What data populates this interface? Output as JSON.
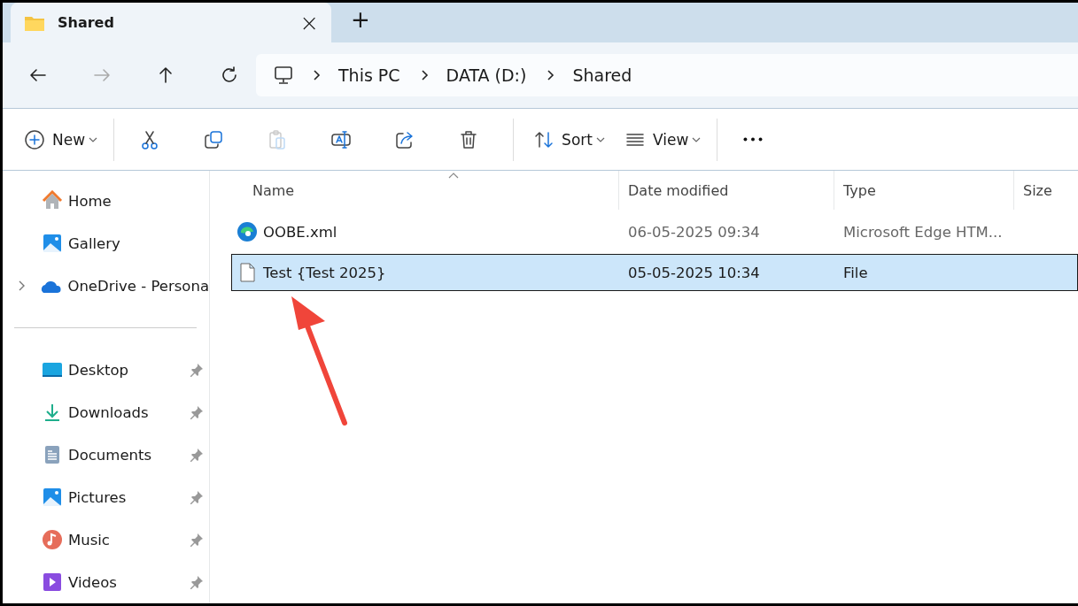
{
  "tab": {
    "title": "Shared",
    "close": "×",
    "new_tab": "+"
  },
  "nav_buttons": [
    {
      "kind": "back",
      "disabled": false
    },
    {
      "kind": "forward",
      "disabled": true
    },
    {
      "kind": "up",
      "disabled": false
    },
    {
      "kind": "refresh",
      "disabled": false
    }
  ],
  "breadcrumb": [
    "This PC",
    "DATA (D:)",
    "Shared"
  ],
  "toolbar": [
    {
      "kind": "new",
      "label": "New",
      "disabled": false
    },
    {
      "kind": "sep"
    },
    {
      "kind": "cut",
      "disabled": false
    },
    {
      "kind": "copy",
      "disabled": false
    },
    {
      "kind": "paste",
      "disabled": true
    },
    {
      "kind": "rename",
      "disabled": false
    },
    {
      "kind": "share",
      "disabled": false
    },
    {
      "kind": "delete",
      "disabled": false
    },
    {
      "kind": "sep"
    },
    {
      "kind": "sort",
      "label": "Sort",
      "disabled": false
    },
    {
      "kind": "view",
      "label": "View",
      "disabled": false
    },
    {
      "kind": "sep"
    },
    {
      "kind": "more",
      "disabled": false
    }
  ],
  "sidebar": {
    "items": [
      {
        "kind": "home",
        "label": "Home",
        "pinned": false,
        "expandable": false
      },
      {
        "kind": "gallery",
        "label": "Gallery",
        "pinned": false,
        "expandable": false
      },
      {
        "kind": "cloud",
        "label": "OneDrive - Persona",
        "pinned": false,
        "expandable": true
      },
      {
        "kind": "divider"
      },
      {
        "kind": "desktop",
        "label": "Desktop",
        "pinned": true,
        "expandable": false
      },
      {
        "kind": "downloads",
        "label": "Downloads",
        "pinned": true,
        "expandable": false
      },
      {
        "kind": "documents",
        "label": "Documents",
        "pinned": true,
        "expandable": false
      },
      {
        "kind": "pictures",
        "label": "Pictures",
        "pinned": true,
        "expandable": false
      },
      {
        "kind": "music",
        "label": "Music",
        "pinned": true,
        "expandable": false
      },
      {
        "kind": "videos",
        "label": "Videos",
        "pinned": true,
        "expandable": false
      }
    ]
  },
  "table": {
    "columns": [
      "Name",
      "Date modified",
      "Type",
      "Size"
    ],
    "rows": [
      {
        "kind": "edge",
        "name": "OOBE.xml",
        "date": "06-05-2025 09:34",
        "type": "Microsoft Edge HTM...",
        "selected": false
      },
      {
        "kind": "file",
        "name": "Test {Test 2025}",
        "date": "05-05-2025 10:34",
        "type": "File",
        "selected": true
      }
    ]
  }
}
